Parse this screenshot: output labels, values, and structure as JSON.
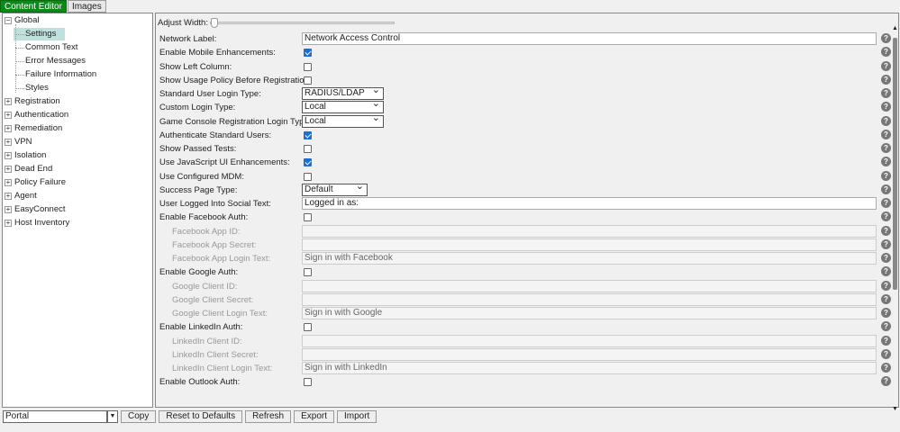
{
  "tabs": [
    "Content Editor",
    "Images"
  ],
  "tree": [
    {
      "label": "Global",
      "level": 0,
      "expanded": true
    },
    {
      "label": "Settings",
      "level": 1,
      "selected": true
    },
    {
      "label": "Common Text",
      "level": 1
    },
    {
      "label": "Error Messages",
      "level": 1
    },
    {
      "label": "Failure Information",
      "level": 1
    },
    {
      "label": "Styles",
      "level": 1
    },
    {
      "label": "Registration",
      "level": 0
    },
    {
      "label": "Authentication",
      "level": 0
    },
    {
      "label": "Remediation",
      "level": 0
    },
    {
      "label": "VPN",
      "level": 0
    },
    {
      "label": "Isolation",
      "level": 0
    },
    {
      "label": "Dead End",
      "level": 0
    },
    {
      "label": "Policy Failure",
      "level": 0
    },
    {
      "label": "Agent",
      "level": 0
    },
    {
      "label": "EasyConnect",
      "level": 0
    },
    {
      "label": "Host Inventory",
      "level": 0
    }
  ],
  "adjust_width_label": "Adjust Width:",
  "rows": [
    {
      "label": "Network Label:",
      "type": "text",
      "value": "Network Access Control"
    },
    {
      "label": "Enable Mobile Enhancements:",
      "type": "check",
      "checked": true
    },
    {
      "label": "Show Left Column:",
      "type": "check",
      "checked": false
    },
    {
      "label": "Show Usage Policy Before Registration:",
      "type": "check",
      "checked": false
    },
    {
      "label": "Standard User Login Type:",
      "type": "select",
      "value": "RADIUS/LDAP"
    },
    {
      "label": "Custom Login Type:",
      "type": "select",
      "value": "Local"
    },
    {
      "label": "Game Console Registration Login Type:",
      "type": "select",
      "value": "Local"
    },
    {
      "label": "Authenticate Standard Users:",
      "type": "check",
      "checked": true
    },
    {
      "label": "Show Passed Tests:",
      "type": "check",
      "checked": false
    },
    {
      "label": "Use JavaScript UI Enhancements:",
      "type": "check",
      "checked": true
    },
    {
      "label": "Use Configured MDM:",
      "type": "check",
      "checked": false
    },
    {
      "label": "Success Page Type:",
      "type": "select",
      "value": "Default",
      "w": "short"
    },
    {
      "label": "User Logged Into Social Text:",
      "type": "text",
      "value": "Logged in as:"
    },
    {
      "label": "Enable Facebook Auth:",
      "type": "check",
      "checked": false
    },
    {
      "label": "Facebook App ID:",
      "type": "text",
      "value": "",
      "sub": true
    },
    {
      "label": "Facebook App Secret:",
      "type": "text",
      "value": "",
      "sub": true
    },
    {
      "label": "Facebook App Login Text:",
      "type": "text",
      "value": "Sign in with Facebook",
      "sub": true
    },
    {
      "label": "Enable Google Auth:",
      "type": "check",
      "checked": false
    },
    {
      "label": "Google Client ID:",
      "type": "text",
      "value": "",
      "sub": true
    },
    {
      "label": "Google Client Secret:",
      "type": "text",
      "value": "",
      "sub": true
    },
    {
      "label": "Google Client Login Text:",
      "type": "text",
      "value": "Sign in with Google",
      "sub": true
    },
    {
      "label": "Enable LinkedIn Auth:",
      "type": "check",
      "checked": false
    },
    {
      "label": "LinkedIn Client ID:",
      "type": "text",
      "value": "",
      "sub": true
    },
    {
      "label": "LinkedIn Client Secret:",
      "type": "text",
      "value": "",
      "sub": true
    },
    {
      "label": "LinkedIn Client Login Text:",
      "type": "text",
      "value": "Sign in with LinkedIn",
      "sub": true
    },
    {
      "label": "Enable Outlook Auth:",
      "type": "check",
      "checked": false
    }
  ],
  "bottom": {
    "portal": "Portal",
    "copy": "Copy",
    "reset": "Reset to Defaults",
    "refresh": "Refresh",
    "export": "Export",
    "import": "Import"
  }
}
